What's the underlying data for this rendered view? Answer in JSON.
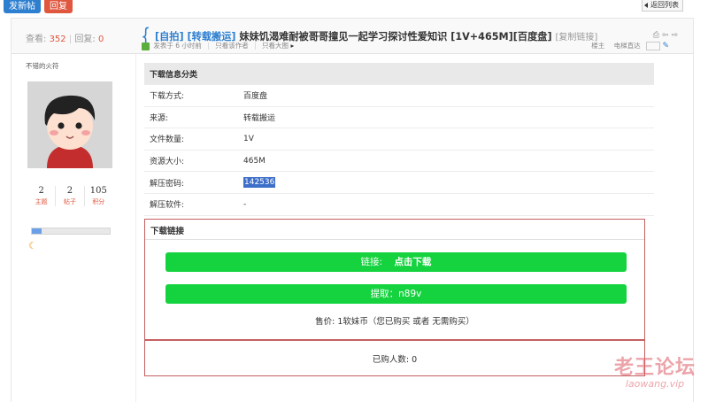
{
  "toolbar": {
    "new_post": "发新帖",
    "reply": "回复",
    "back_list": "返回列表"
  },
  "thread": {
    "views_label": "查看:",
    "views": "352",
    "replies_label": "回复:",
    "replies": "0",
    "cat1": "[自拍]",
    "cat2": "[转载搬运]",
    "title": "妹妹饥渴难耐被哥哥撞见一起学习探讨性爱知识 [1V+465M][百度盘]",
    "copy_link": "[复制链接]"
  },
  "author": {
    "name": "不错的火符",
    "stats": [
      {
        "value": "2",
        "label": "主题"
      },
      {
        "value": "2",
        "label": "帖子"
      },
      {
        "value": "105",
        "label": "积分"
      }
    ],
    "level_progress": 0.12
  },
  "post_meta": {
    "posted": "发表于 6 小时前",
    "only_author": "只看该作者",
    "large_image": "只看大图",
    "floor": "楼主",
    "reading_mode": "电梯直达"
  },
  "download_info": {
    "header": "下载信息分类",
    "rows": [
      {
        "label": "下载方式:",
        "value": "百度盘"
      },
      {
        "label": "来源:",
        "value": "转载搬运"
      },
      {
        "label": "文件数量:",
        "value": "1V"
      },
      {
        "label": "资源大小:",
        "value": "465M"
      },
      {
        "label": "解压密码:",
        "value": "142536"
      },
      {
        "label": "解压软件:",
        "value": "-"
      }
    ]
  },
  "download_box": {
    "title": "下载链接",
    "link_label": "链接:",
    "link_action": "点击下载",
    "code_text": "提取：n89v",
    "price": "售价:  1软妹币（您已购买 或者 无需购买）",
    "buyers": "已购人数:  0"
  },
  "watermark": {
    "cn": "老王论坛",
    "en": "laowang.vip"
  },
  "colors": {
    "accent": "#2d7fd0",
    "reply": "#e0573f",
    "download_green": "#14d33e",
    "box_border": "#c46060"
  }
}
